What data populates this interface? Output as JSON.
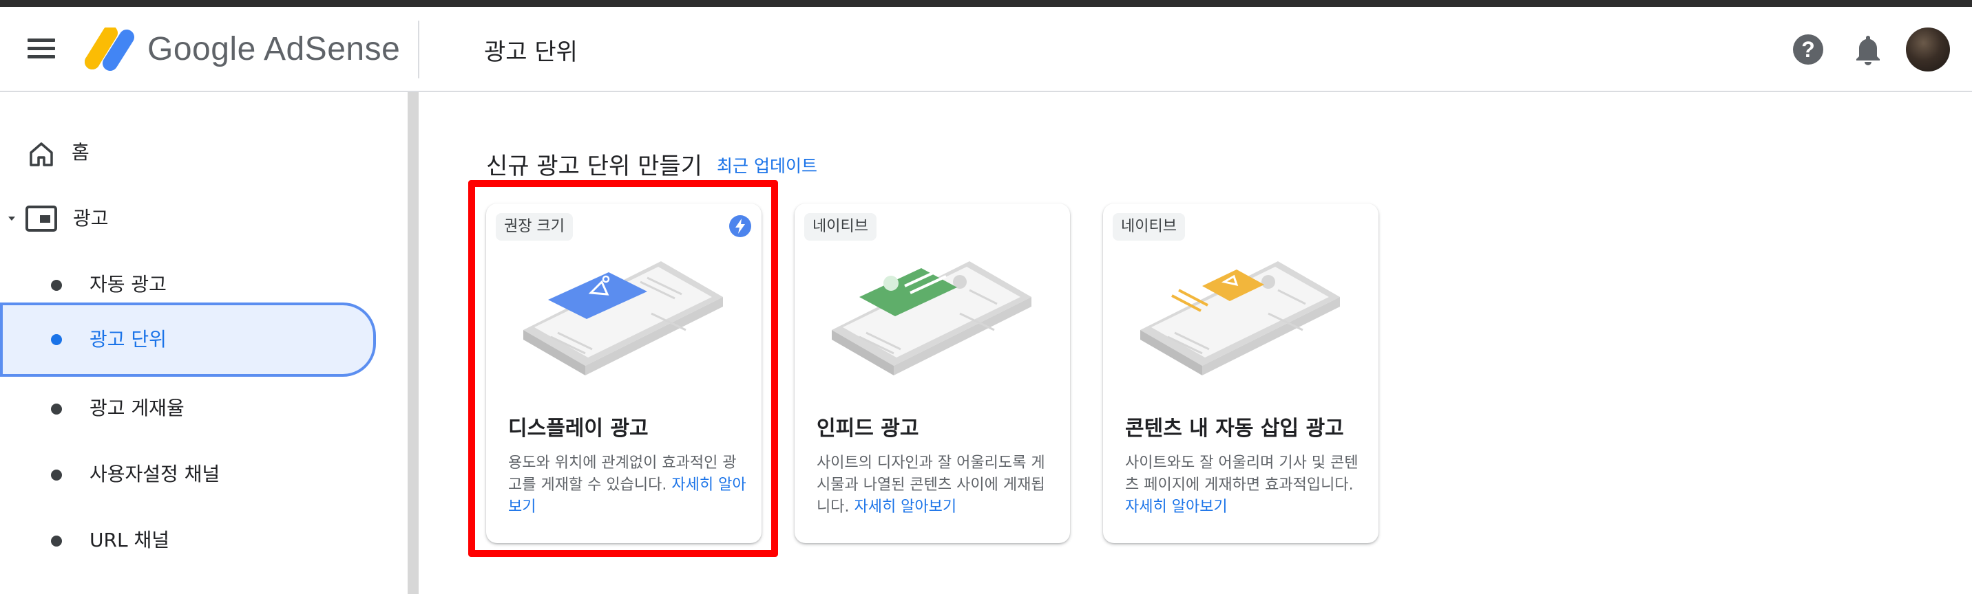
{
  "header": {
    "logo_text": "Google AdSense",
    "page_title": "광고 단위",
    "icons": [
      "menu-icon",
      "help-icon",
      "notifications-bell-icon",
      "account-avatar"
    ]
  },
  "sidebar": {
    "items": [
      {
        "label": "홈",
        "icon": "home-icon"
      },
      {
        "label": "광고",
        "icon": "ads-icon",
        "expanded": true
      },
      {
        "label": "자동 광고"
      },
      {
        "label": "광고 단위",
        "active": true
      },
      {
        "label": "광고 게재율"
      },
      {
        "label": "사용자설정 채널"
      },
      {
        "label": "URL 채널"
      }
    ]
  },
  "main": {
    "section_title": "신규 광고 단위 만들기",
    "section_link": "최근 업데이트",
    "cards": [
      {
        "chip": "권장 크기",
        "title": "디스플레이 광고",
        "desc": "용도와 위치에 관계없이 효과적인 광고를 게재할 수 있습니다. ",
        "link": "자세히 알아보기",
        "accent": "#5b8def",
        "highlighted": true
      },
      {
        "chip": "네이티브",
        "title": "인피드 광고",
        "desc": "사이트의 디자인과 잘 어울리도록 게시물과 나열된 콘텐츠 사이에 게재됩니다. ",
        "link": "자세히 알아보기",
        "accent": "#5fae6a"
      },
      {
        "chip": "네이티브",
        "title": "콘텐츠 내 자동 삽입 광고",
        "desc": "사이트와도 잘 어울리며 기사 및 콘텐츠 페이지에 게재하면 효과적입니다. ",
        "link": "자세히 알아보기",
        "accent": "#f2b63c"
      }
    ]
  },
  "colors": {
    "brand_blue": "#1a73e8",
    "highlight_red": "#ff0000",
    "active_bg": "#e8f0fe"
  }
}
